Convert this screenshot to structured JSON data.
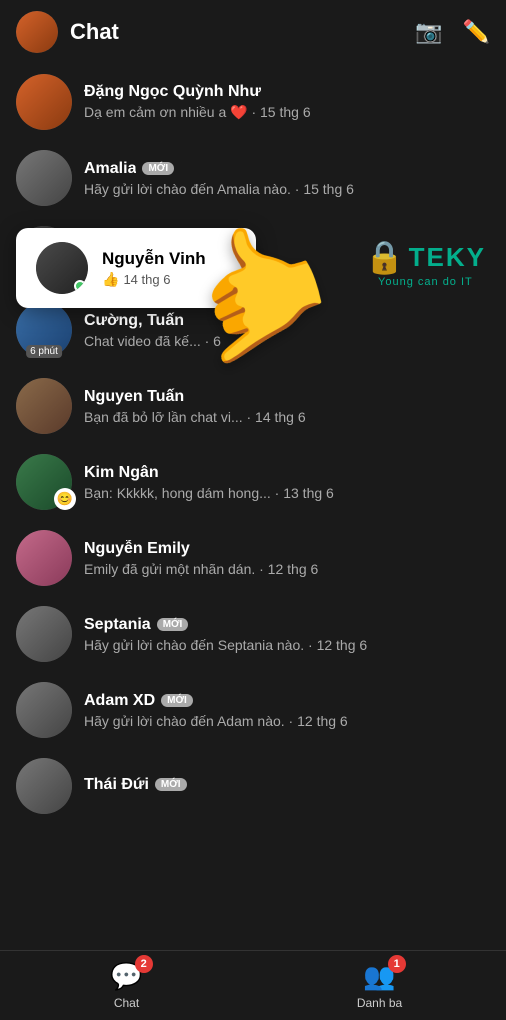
{
  "header": {
    "title": "Chat",
    "camera_icon": "📷",
    "edit_icon": "✏️"
  },
  "popup": {
    "name": "Nguyễn Vinh",
    "meta": "14 thg 6",
    "thumb": "👍"
  },
  "chats": [
    {
      "id": 1,
      "name": "Đặng Ngọc Quỳnh Như",
      "message": "Dạ em cảm ơn nhiều a ❤️",
      "time": "· 15 thg 6",
      "avatar_class": "av-orange",
      "has_online": false,
      "time_badge": null,
      "reaction": null,
      "new_badge": null
    },
    {
      "id": 2,
      "name": "Amalia",
      "message": "Hãy gửi lời chào đến Amalia nào.",
      "time": "· 15 thg 6",
      "avatar_class": "av-gray",
      "has_online": false,
      "time_badge": null,
      "reaction": null,
      "new_badge": "MỚI"
    },
    {
      "id": 3,
      "name": "Nguyễn Vinh",
      "message": "👍 · 14 thg 6",
      "time": "",
      "avatar_class": "av-dark",
      "has_online": true,
      "time_badge": null,
      "reaction": null,
      "new_badge": null,
      "is_popup": true
    },
    {
      "id": 4,
      "name": "Cường, Tuấn",
      "message": "Chat video đã kế...",
      "time": "· 6",
      "avatar_class": "av-blue",
      "has_online": false,
      "time_badge": "6 phút",
      "reaction": null,
      "new_badge": null
    },
    {
      "id": 5,
      "name": "Nguyen Tuấn",
      "message": "Bạn đã bỏ lỡ lần chat vi...",
      "time": "· 14 thg 6",
      "avatar_class": "av-brown",
      "has_online": false,
      "time_badge": null,
      "reaction": null,
      "new_badge": null
    },
    {
      "id": 6,
      "name": "Kim Ngân",
      "message": "Bạn: Kkkkk, hong dám hong...",
      "time": "· 13 thg 6",
      "avatar_class": "av-green",
      "has_online": true,
      "time_badge": null,
      "reaction": "😊",
      "new_badge": null
    },
    {
      "id": 7,
      "name": "Nguyễn Emily",
      "message": "Emily đã gửi một nhãn dán.",
      "time": "· 12 thg 6",
      "avatar_class": "av-pink",
      "has_online": false,
      "time_badge": null,
      "reaction": null,
      "new_badge": null
    },
    {
      "id": 8,
      "name": "Septania",
      "message": "Hãy gửi lời chào đến Septania nào.",
      "time": "· 12 thg 6",
      "avatar_class": "av-gray",
      "has_online": false,
      "time_badge": null,
      "reaction": null,
      "new_badge": "MỚI"
    },
    {
      "id": 9,
      "name": "Adam XD",
      "message": "Hãy gửi lời chào đến Adam nào.",
      "time": "· 12 thg 6",
      "avatar_class": "av-gray",
      "has_online": false,
      "time_badge": null,
      "reaction": null,
      "new_badge": "MỚI"
    },
    {
      "id": 10,
      "name": "Thái Đứi",
      "message": "",
      "time": "",
      "avatar_class": "av-gray",
      "has_online": false,
      "time_badge": null,
      "reaction": null,
      "new_badge": "MỚI"
    }
  ],
  "bottom_nav": [
    {
      "label": "Chat",
      "icon": "💬",
      "badge": "2",
      "active": true
    },
    {
      "label": "Danh ba",
      "icon": "👥",
      "badge": "1",
      "active": false
    }
  ],
  "watermark": {
    "text": "TEKY",
    "sub": "Young can do IT"
  }
}
